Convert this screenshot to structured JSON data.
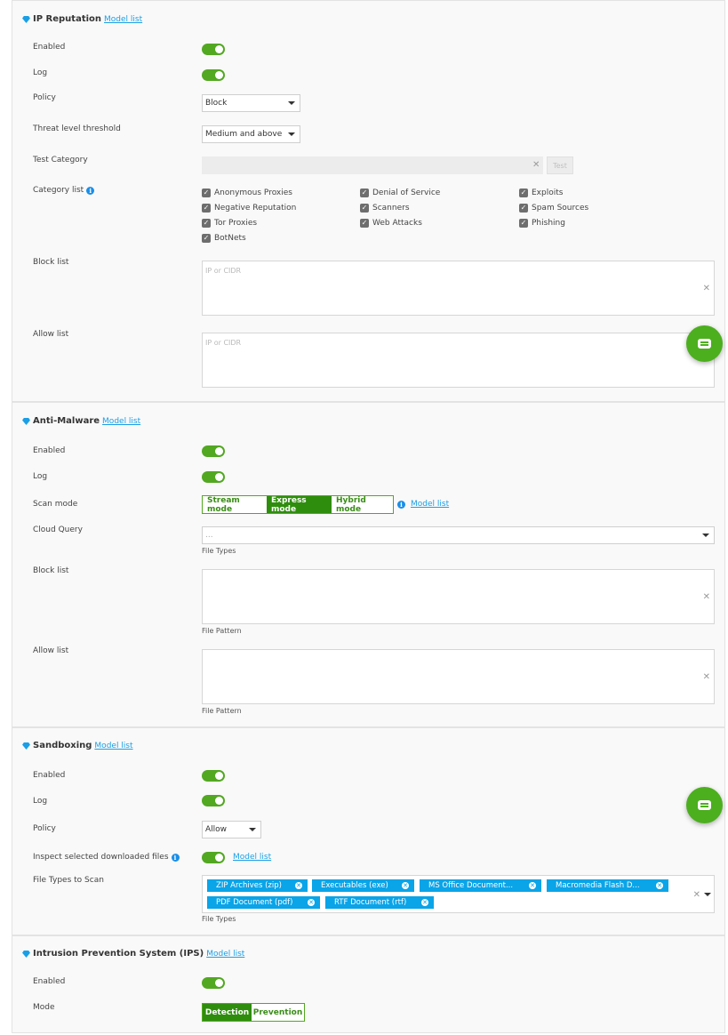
{
  "colors": {
    "accent_green": "#52a821",
    "link_blue": "#1a9fe6",
    "tag_blue": "#0aa4e8"
  },
  "ip_reputation": {
    "title": "IP Reputation",
    "model_list": "Model list",
    "enabled_label": "Enabled",
    "log_label": "Log",
    "policy_label": "Policy",
    "policy_value": "Block",
    "threat_label": "Threat level threshold",
    "threat_value": "Medium and above",
    "test_category_label": "Test Category",
    "test_button": "Test",
    "category_list_label": "Category list",
    "categories": [
      "Anonymous Proxies",
      "Denial of Service",
      "Exploits",
      "Negative Reputation",
      "Scanners",
      "Spam Sources",
      "Tor Proxies",
      "Web Attacks",
      "Phishing",
      "BotNets"
    ],
    "block_list_label": "Block list",
    "block_placeholder": "IP or CIDR",
    "allow_list_label": "Allow list",
    "allow_placeholder": "IP or CIDR"
  },
  "anti_malware": {
    "title": "Anti-Malware",
    "model_list": "Model list",
    "enabled_label": "Enabled",
    "log_label": "Log",
    "scan_mode_label": "Scan mode",
    "scan_modes": [
      "Stream mode",
      "Express mode",
      "Hybrid mode"
    ],
    "scan_mode_selected": "Express mode",
    "scan_model_list": "Model list",
    "cloud_query_label": "Cloud Query",
    "cloud_query_value": "...",
    "file_types_caption": "File Types",
    "block_list_label": "Block list",
    "block_caption": "File Pattern",
    "allow_list_label": "Allow list",
    "allow_caption": "File Pattern"
  },
  "sandboxing": {
    "title": "Sandboxing",
    "model_list": "Model list",
    "enabled_label": "Enabled",
    "log_label": "Log",
    "policy_label": "Policy",
    "policy_value": "Allow",
    "inspect_label": "Inspect selected downloaded files",
    "inspect_model_list": "Model list",
    "file_types_label": "File Types to Scan",
    "file_types": [
      "ZIP Archives (zip)",
      "Executables (exe)",
      "MS Office Document...",
      "Macromedia Flash D...",
      "PDF Document (pdf)",
      "RTF Document (rtf)"
    ],
    "file_types_caption": "File Types"
  },
  "ips": {
    "title": "Intrusion Prevention System (IPS)",
    "model_list": "Model list",
    "enabled_label": "Enabled",
    "mode_label": "Mode",
    "modes": [
      "Detection",
      "Prevention"
    ],
    "mode_selected": "Detection"
  }
}
